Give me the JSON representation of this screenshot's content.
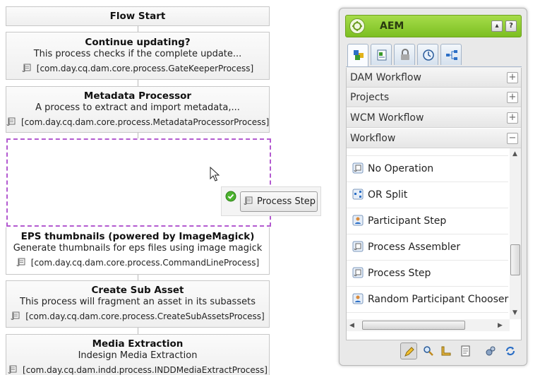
{
  "workflow": {
    "flow_start": "Flow Start",
    "steps": [
      {
        "title": "Continue updating?",
        "description": "This process checks if the complete update...",
        "class_name": "[com.day.cq.dam.core.process.GateKeeperProcess]"
      },
      {
        "title": "Metadata Processor",
        "description": "A process to extract and import metadata,...",
        "class_name": "[com.day.cq.dam.core.process.MetadataProcessorProcess]"
      },
      {
        "title": "EPS thumbnails (powered by ImageMagick)",
        "description": "Generate thumbnails for eps files using image magick",
        "class_name": "[com.day.cq.dam.core.process.CommandLineProcess]"
      },
      {
        "title": "Create Sub Asset",
        "description": "This process will fragment an asset in its subassets",
        "class_name": "[com.day.cq.dam.core.process.CreateSubAssetsProcess]"
      },
      {
        "title": "Media Extraction",
        "description": "Indesign Media Extraction",
        "class_name": "[com.day.cq.dam.indd.process.INDDMediaExtractProcess]"
      }
    ],
    "drag_label": "Process Step"
  },
  "sidekick": {
    "title": "AEM",
    "groups": [
      {
        "label": "DAM Workflow",
        "toggle": "+"
      },
      {
        "label": "Projects",
        "toggle": "+"
      },
      {
        "label": "WCM Workflow",
        "toggle": "+"
      },
      {
        "label": "Workflow",
        "toggle": "−"
      }
    ],
    "items": [
      {
        "label": "No Operation",
        "icon": "scroll-icon"
      },
      {
        "label": "OR Split",
        "icon": "split-icon"
      },
      {
        "label": "Participant Step",
        "icon": "participant-icon"
      },
      {
        "label": "Process Assembler",
        "icon": "scroll-icon"
      },
      {
        "label": "Process Step",
        "icon": "scroll-icon"
      },
      {
        "label": "Random Participant Chooser",
        "icon": "participant-icon"
      }
    ],
    "colors": {
      "header": "#8cc63f",
      "drop_zone": "#b35ad0"
    }
  }
}
